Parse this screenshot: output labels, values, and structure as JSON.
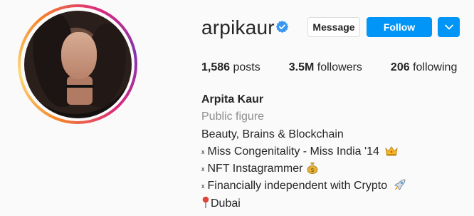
{
  "profile": {
    "username": "arpikaur",
    "verified": true,
    "verified_icon": "verified-badge-icon",
    "buttons": {
      "message": "Message",
      "follow": "Follow",
      "dropdown_icon": "chevron-down-icon"
    },
    "stats": [
      {
        "value": "1,586",
        "label": "posts"
      },
      {
        "value": "3.5M",
        "label": "followers"
      },
      {
        "value": "206",
        "label": "following"
      }
    ],
    "full_name": "Arpita Kaur",
    "category": "Public figure",
    "bio_lines": [
      {
        "bullet": "",
        "text": "Beauty, Brains & Blockchain",
        "emoji": ""
      },
      {
        "bullet": "x",
        "text": "Miss Congenitality - Miss India '14",
        "emoji": "crown-icon"
      },
      {
        "bullet": "x",
        "text": "NFT Instagrammer",
        "emoji": "money-bag-icon"
      },
      {
        "bullet": "x",
        "text": "Financially independent with Crypto",
        "emoji": "rocket-icon"
      },
      {
        "bullet": "",
        "text": "Dubai",
        "emoji": "pin-icon"
      }
    ]
  },
  "colors": {
    "background": "#fafafa",
    "follow_blue": "#0095f6",
    "muted_text": "#8e8e8e",
    "verified_blue": "#3897f0"
  }
}
